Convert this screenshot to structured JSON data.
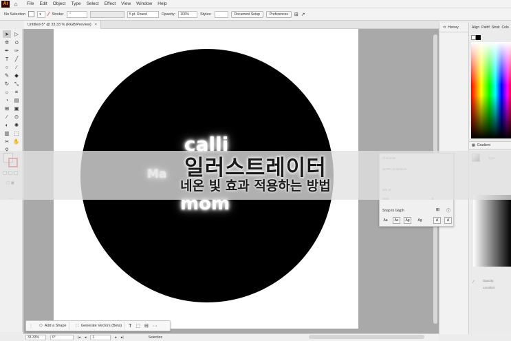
{
  "menubar": {
    "logo": "Ai",
    "items": [
      "File",
      "Edit",
      "Object",
      "Type",
      "Select",
      "Effect",
      "View",
      "Window",
      "Help"
    ]
  },
  "control": {
    "selection": "No Selection",
    "stroke_label": "Stroke:",
    "brush": "5 pt. Round",
    "opacity_label": "Opacity:",
    "opacity": "100%",
    "style_label": "Styles:",
    "doc_setup": "Document Setup",
    "preferences": "Preferences"
  },
  "document": {
    "tab": "Untitled-5* @ 33.33 % (RGB/Preview)",
    "close": "×"
  },
  "artwork": {
    "line1": "calli",
    "line2": "mom"
  },
  "banner": {
    "title": "일러스트레이터",
    "subtitle": "네온 빛 효과 적용하는 방법"
  },
  "panels": {
    "history": "History",
    "right_tabs": [
      "Align",
      "Pathf",
      "Strok",
      "Colo"
    ],
    "gradient": "Gradient",
    "gradient_type": "Type:",
    "opacity_label": "Opacity:",
    "location_label": "Location:"
  },
  "character": {
    "title": "Character",
    "font": "SUSE UI Medium",
    "snap": "Snap to Glyph",
    "size": "102 pt",
    "tracking": "Auto",
    "kerning": "0"
  },
  "context": {
    "add_shape": "Add a Shape",
    "generate": "Generate Vectors (Beta)"
  },
  "status": {
    "zoom": "33.33%",
    "angle": "0°",
    "artboard": "1",
    "tool": "Selection"
  }
}
